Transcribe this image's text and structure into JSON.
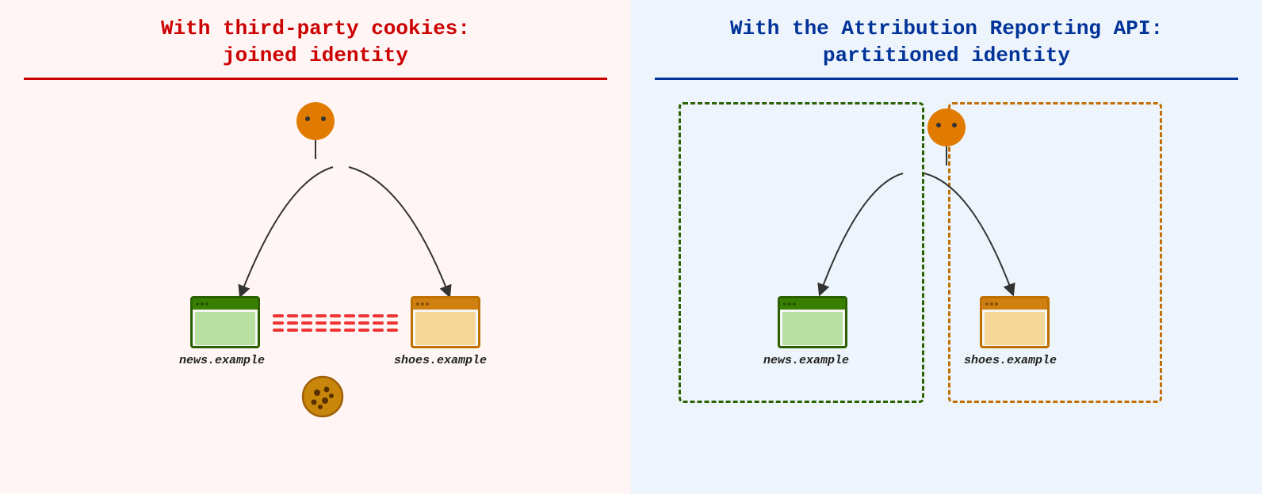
{
  "left": {
    "title_line1": "With third-party cookies:",
    "title_line2": "joined identity",
    "site1_label": "news.example",
    "site2_label": "shoes.example"
  },
  "right": {
    "title_line1": "With the Attribution Reporting API:",
    "title_line2": "partitioned identity",
    "site1_label": "news.example",
    "site2_label": "shoes.example"
  }
}
